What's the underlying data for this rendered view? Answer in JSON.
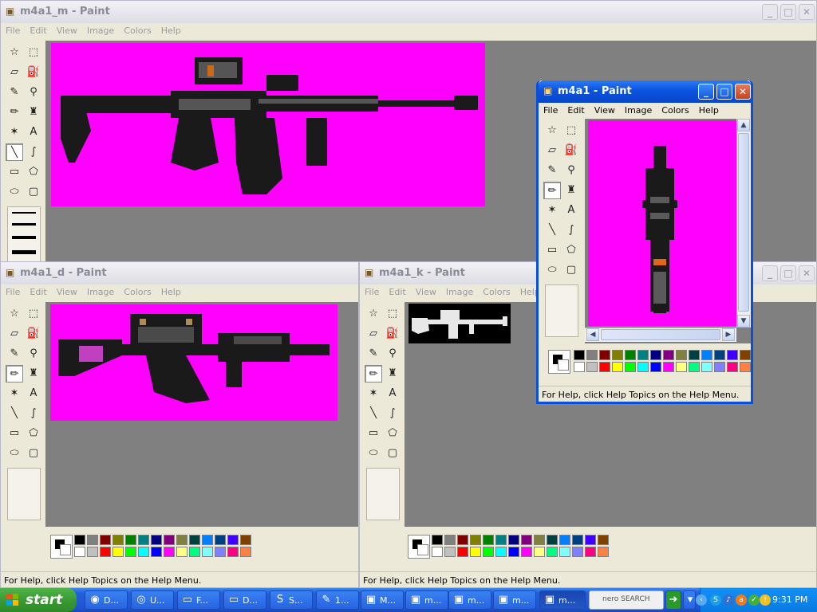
{
  "menu_items": [
    "File",
    "Edit",
    "View",
    "Image",
    "Colors",
    "Help"
  ],
  "status_text": "For Help, click Help Topics on the Help Menu.",
  "windows": {
    "m": {
      "title": "m4a1_m - Paint"
    },
    "d": {
      "title": "m4a1_d - Paint"
    },
    "k": {
      "title": "m4a1_k - Paint"
    },
    "main": {
      "title": "m4a1 - Paint"
    }
  },
  "icons": {
    "tools": [
      "free-form-select-icon",
      "select-icon",
      "eraser-icon",
      "fill-with-color-icon",
      "pick-color-icon",
      "magnifier-icon",
      "pencil-icon",
      "brush-icon",
      "airbrush-icon",
      "text-icon",
      "line-icon",
      "curve-icon",
      "rectangle-icon",
      "polygon-icon",
      "ellipse-icon",
      "rounded-rectangle-icon"
    ],
    "tool_glyphs": [
      "☆",
      "⬚",
      "▱",
      "⛽",
      "✎",
      "⚲",
      "✏",
      "♜",
      "✶",
      "A",
      "╲",
      "∫",
      "▭",
      "⬠",
      "⬭",
      "▢"
    ]
  },
  "palette_colors": {
    "top": [
      "#000000",
      "#808080",
      "#800000",
      "#808000",
      "#008000",
      "#008080",
      "#000080",
      "#800080",
      "#808040",
      "#004040",
      "#0080ff",
      "#004080",
      "#4000ff",
      "#804000"
    ],
    "bottom": [
      "#ffffff",
      "#c0c0c0",
      "#ff0000",
      "#ffff00",
      "#00ff00",
      "#00ffff",
      "#0000ff",
      "#ff00ff",
      "#ffff80",
      "#00ff80",
      "#80ffff",
      "#8080ff",
      "#ff0080",
      "#ff8040"
    ]
  },
  "canvas_color": "#ff00ff",
  "taskbar": {
    "start_label": "start",
    "buttons": [
      {
        "icon": "firefox-icon",
        "glyph": "◉",
        "label": "D..."
      },
      {
        "icon": "chrome-icon",
        "glyph": "◎",
        "label": "U..."
      },
      {
        "icon": "folder-icon",
        "glyph": "▭",
        "label": "F..."
      },
      {
        "icon": "folder-icon",
        "glyph": "▭",
        "label": "D..."
      },
      {
        "icon": "skype-icon",
        "glyph": "S",
        "label": "S..."
      },
      {
        "icon": "pencil-app-icon",
        "glyph": "✎",
        "label": "1..."
      },
      {
        "icon": "paint-icon",
        "glyph": "▣",
        "label": "M..."
      },
      {
        "icon": "paint-icon",
        "glyph": "▣",
        "label": "m..."
      },
      {
        "icon": "paint-icon",
        "glyph": "▣",
        "label": "m..."
      },
      {
        "icon": "paint-icon",
        "glyph": "▣",
        "label": "m..."
      },
      {
        "icon": "paint-icon",
        "glyph": "▣",
        "label": "m..."
      }
    ],
    "nero_label": "nero SEARCH",
    "clock": "9:31 PM"
  }
}
